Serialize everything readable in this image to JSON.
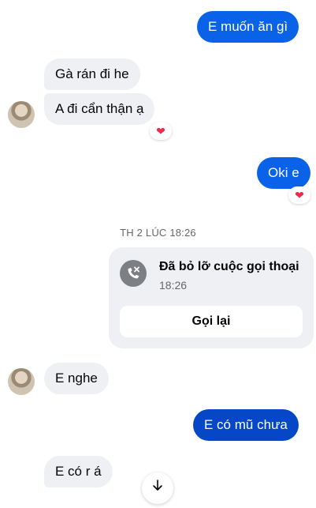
{
  "messages": {
    "m1": "E muốn ăn gì",
    "m2": "Gà rán đi he",
    "m3": "A đi cẩn thận ạ",
    "m4": "Oki e",
    "m5": "E nghe",
    "m6": "E có mũ chưa",
    "m7": "E có r á"
  },
  "reactions": {
    "heart": "❤"
  },
  "divider": {
    "timestamp": "TH 2 LÚC 18:26"
  },
  "call": {
    "title": "Đã bỏ lỡ cuộc gọi thoại",
    "time": "18:26",
    "callback_label": "Gọi lại"
  },
  "colors": {
    "outgoing": "#0a62e8",
    "incoming": "#eef0f3",
    "reaction": "#f02849"
  },
  "icons": {
    "missed_call": "missed-call-icon",
    "scroll_down": "arrow-down-icon"
  }
}
